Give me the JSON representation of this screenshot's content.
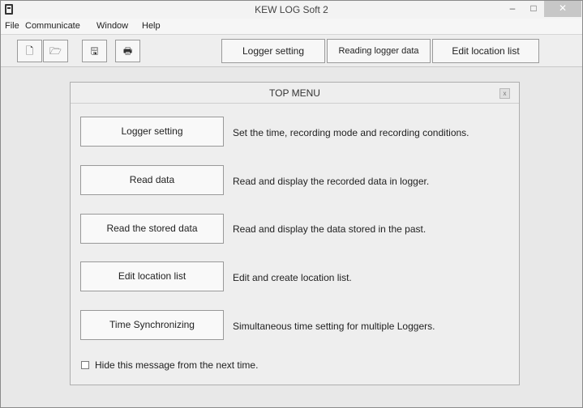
{
  "window": {
    "title": "KEW LOG Soft 2",
    "controls": {
      "minimize": "–",
      "maximize": "□",
      "close": "✕"
    }
  },
  "menubar": {
    "items": [
      "File",
      "Communicate",
      "Window",
      "Help"
    ]
  },
  "toolbar": {
    "icon_buttons": [
      {
        "icon": "new-file-icon",
        "glyph": "🗋"
      },
      {
        "icon": "open-folder-icon",
        "glyph": "🗁"
      },
      {
        "icon": "save-disk-icon",
        "glyph": "🖫"
      },
      {
        "icon": "print-icon",
        "glyph": "🖶"
      }
    ],
    "logger_setting": "Logger setting",
    "reading_logger_data": "Reading logger data",
    "edit_location_list": "Edit location list"
  },
  "dialog": {
    "title": "TOP MENU",
    "close_glyph": "x",
    "actions": [
      {
        "label": "Logger setting",
        "description": "Set the time, recording mode and recording conditions."
      },
      {
        "label": "Read data",
        "description": "Read and display the recorded data in logger."
      },
      {
        "label": "Read the stored data",
        "description": "Read and display the data stored in the past."
      },
      {
        "label": "Edit location list",
        "description": "Edit and create location list."
      },
      {
        "label": "Time Synchronizing",
        "description": "Simultaneous time setting for multiple Loggers."
      }
    ],
    "hide_message": {
      "label": "Hide this message from the next time.",
      "checked": false
    }
  }
}
